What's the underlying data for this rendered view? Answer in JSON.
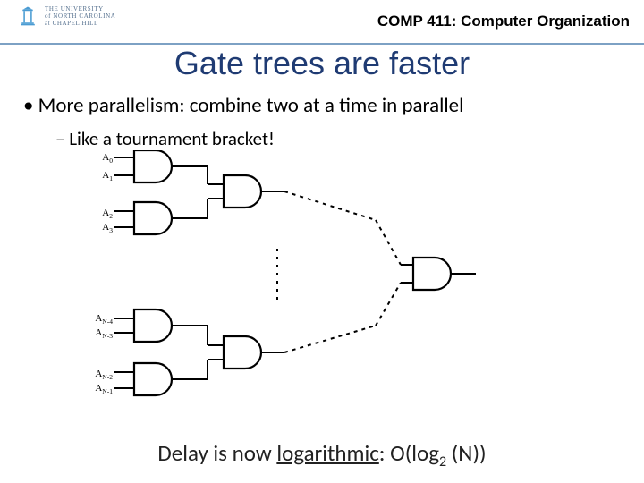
{
  "header": {
    "institution_line1": "THE UNIVERSITY",
    "institution_line2": "of NORTH CAROLINA",
    "institution_line3": "at CHAPEL HILL",
    "course": "COMP 411: Computer Organization"
  },
  "title": "Gate trees are faster",
  "bullets": {
    "b1": "More parallelism:  combine two at a time in parallel",
    "b2": "Like a tournament bracket!"
  },
  "labels": {
    "a0": "A",
    "a0_sub": "0",
    "a1": "A",
    "a1_sub": "1",
    "a2": "A",
    "a2_sub": "2",
    "a3": "A",
    "a3_sub": "3",
    "an4": "A",
    "an4_sub": "N-4",
    "an3": "A",
    "an3_sub": "N-3",
    "an2": "A",
    "an2_sub": "N-2",
    "an1": "A",
    "an1_sub": "N-1"
  },
  "footer": {
    "pre": "Delay is now ",
    "underlined": "logarithmic",
    "post1": ": O(log",
    "sub": "2",
    "post2": " (N))"
  }
}
